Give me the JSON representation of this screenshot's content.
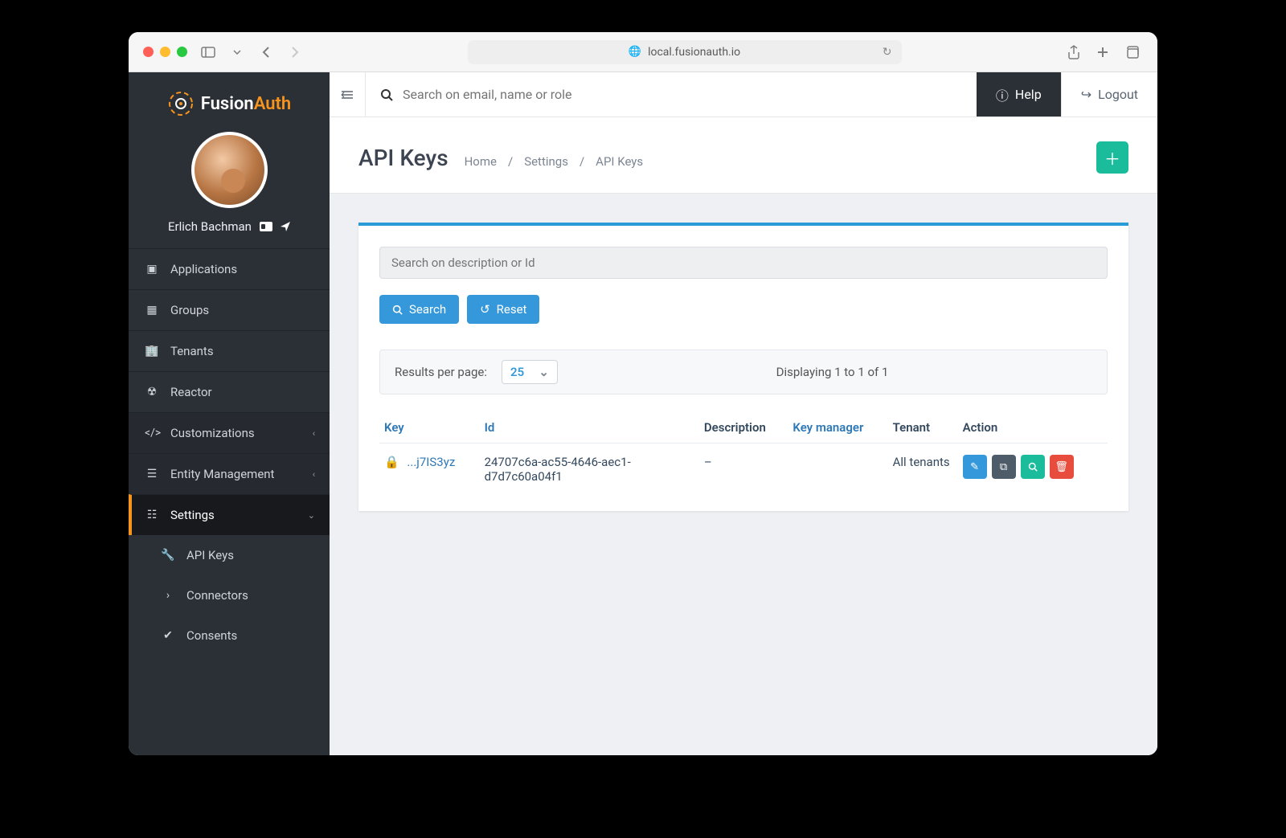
{
  "browser": {
    "url": "local.fusionauth.io"
  },
  "brand": {
    "name_a": "Fusion",
    "name_b": "Auth"
  },
  "user": {
    "name": "Erlich Bachman"
  },
  "sidebar": {
    "items": [
      {
        "label": "Applications"
      },
      {
        "label": "Groups"
      },
      {
        "label": "Tenants"
      },
      {
        "label": "Reactor"
      },
      {
        "label": "Customizations"
      },
      {
        "label": "Entity Management"
      },
      {
        "label": "Settings"
      },
      {
        "label": "API Keys"
      },
      {
        "label": "Connectors"
      },
      {
        "label": "Consents"
      }
    ]
  },
  "topbar": {
    "search_placeholder": "Search on email, name or role",
    "help": "Help",
    "logout": "Logout"
  },
  "page": {
    "title": "API Keys",
    "breadcrumb": [
      "Home",
      "Settings",
      "API Keys"
    ]
  },
  "filter": {
    "placeholder": "Search on description or Id",
    "search_label": "Search",
    "reset_label": "Reset"
  },
  "pager": {
    "label": "Results per page:",
    "value": "25",
    "display": "Displaying 1 to 1 of 1"
  },
  "table": {
    "headers": {
      "key": "Key",
      "id": "Id",
      "description": "Description",
      "key_manager": "Key manager",
      "tenant": "Tenant",
      "action": "Action"
    },
    "rows": [
      {
        "key": "...j7IS3yz",
        "id": "24707c6a-ac55-4646-aec1-d7d7c60a04f1",
        "description": "–",
        "key_manager": "",
        "tenant": "All tenants"
      }
    ]
  }
}
